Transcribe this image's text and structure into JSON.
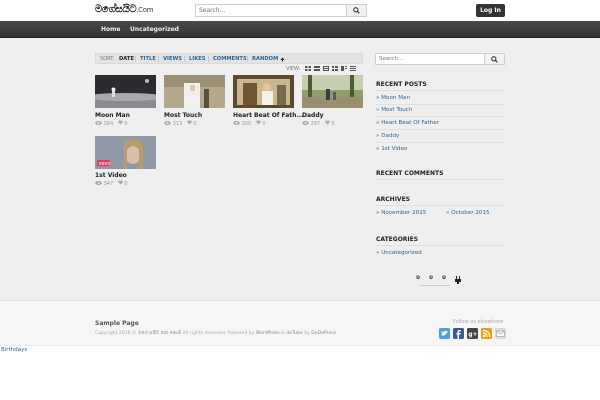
{
  "header": {
    "logo_main": "මගේසයිට",
    "logo_suffix": ".Com",
    "search_placeholder": "Search...",
    "login_label": "Log In"
  },
  "nav": {
    "home": "Home",
    "uncategorized": "Uncategorized"
  },
  "sortbar": {
    "sort_label": "SORT:",
    "items": [
      "DATE",
      "TITLE",
      "VIEWS",
      "LIKES",
      "COMMENTS",
      "RANDOM"
    ],
    "active": "DATE",
    "view_label": "VIEW:"
  },
  "videos": [
    {
      "title": "Moon Man",
      "views": "384",
      "likes": "0"
    },
    {
      "title": "Most Touch",
      "views": "313",
      "likes": "0"
    },
    {
      "title": "Heart Beat Of Fath...",
      "views": "300",
      "likes": "0"
    },
    {
      "title": "Daddy",
      "views": "297",
      "likes": "0"
    },
    {
      "title": "1st Video",
      "views": "347",
      "likes": "0"
    }
  ],
  "sidebar": {
    "search_placeholder": "Search...",
    "recent_posts_title": "RECENT POSTS",
    "recent_posts": [
      "Moon Man",
      "Most Touch",
      "Heart Beat Of Father",
      "Daddy",
      "1st Video"
    ],
    "recent_comments_title": "RECENT COMMENTS",
    "archives_title": "ARCHIVES",
    "archives": [
      "November 2015",
      "October 2015"
    ],
    "categories_title": "CATEGORIES",
    "categories": [
      "Uncategorized"
    ]
  },
  "footer": {
    "sample_page": "Sample Page",
    "copyright_prefix": "Copyright 2016 © ",
    "copyright_site": "මගේ සයිට dot කොම්",
    "copyright_middle": " All rights reserved. Powered by ",
    "wordpress": "WordPress",
    "amp": " & ",
    "theme": "deTube",
    "by": " by ",
    "author": "DeDePress",
    "follow": "Follow us elsewhere"
  },
  "birthdays": "Birthdays",
  "colors": {
    "link": "#2a6496",
    "nav_bg": "#3a3a3a",
    "login_bg": "#333333",
    "vevo": "#e8365d"
  },
  "icons": [
    "search-icon",
    "eye-icon",
    "heart-icon",
    "twitter-icon",
    "facebook-icon",
    "google-plus-icon",
    "rss-icon",
    "email-icon"
  ]
}
